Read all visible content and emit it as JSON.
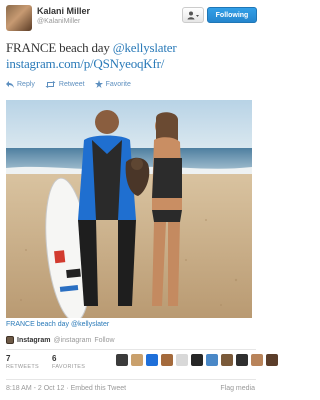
{
  "header": {
    "name": "Kalani Miller",
    "handle": "@KalaniMiller",
    "follow_label": "Following"
  },
  "tweet": {
    "text_plain": "FRANCE beach day ",
    "mention": "@kellyslater",
    "link": "instagram.com/p/QSNyeoqKfr/"
  },
  "actions": {
    "reply": "Reply",
    "retweet": "Retweet",
    "favorite": "Favorite"
  },
  "photo": {
    "caption": "FRANCE beach day @kellyslater"
  },
  "source": {
    "service": "Instagram",
    "handle_text": "@instagram",
    "follow": "Follow"
  },
  "stats": {
    "retweets_count": "7",
    "retweets_label": "RETWEETS",
    "favorites_count": "6",
    "favorites_label": "FAVORITES"
  },
  "faces": [
    "#3b3b3b",
    "#c9a06c",
    "#1e6fd9",
    "#a46a3c",
    "#d8d8d8",
    "#262626",
    "#4a88c7",
    "#7a5a3a",
    "#2f2f2f",
    "#b8835a",
    "#5b3d2a"
  ],
  "footer": {
    "timestamp": "8:18 AM - 2 Oct 12 · Embed this Tweet",
    "flag": "Flag media"
  }
}
